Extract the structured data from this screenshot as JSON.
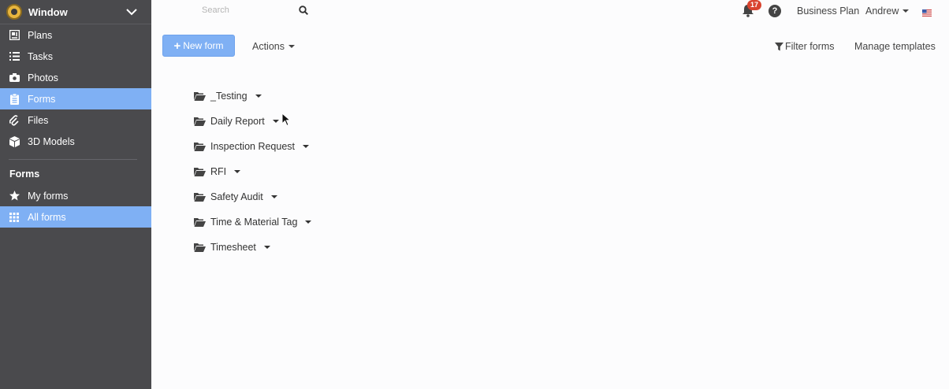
{
  "sidebar": {
    "project_name": "Window",
    "items": [
      {
        "label": "Plans",
        "icon": "plans-icon"
      },
      {
        "label": "Tasks",
        "icon": "list-icon"
      },
      {
        "label": "Photos",
        "icon": "camera-icon"
      },
      {
        "label": "Forms",
        "icon": "clipboard-icon",
        "active": true
      },
      {
        "label": "Files",
        "icon": "paperclip-icon"
      },
      {
        "label": "3D Models",
        "icon": "cube-icon"
      }
    ],
    "section_heading": "Forms",
    "sub_items": [
      {
        "label": "My forms",
        "icon": "star-icon"
      },
      {
        "label": "All forms",
        "icon": "grid-icon",
        "active": true
      }
    ]
  },
  "topbar": {
    "search_placeholder": "Search",
    "notification_count": "17",
    "help_label": "?",
    "plan_label": "Business Plan",
    "user_name": "Andrew"
  },
  "toolbar": {
    "new_form_label": "New form",
    "actions_label": "Actions",
    "filter_label": "Filter forms",
    "manage_label": "Manage templates"
  },
  "folders": [
    {
      "name": "_Testing"
    },
    {
      "name": "Daily Report"
    },
    {
      "name": "Inspection Request"
    },
    {
      "name": "RFI"
    },
    {
      "name": "Safety Audit"
    },
    {
      "name": "Time & Material Tag"
    },
    {
      "name": "Timesheet"
    }
  ],
  "colors": {
    "sidebar_bg": "#4a4a4d",
    "accent": "#7fb0f4",
    "badge": "#d9432f"
  }
}
